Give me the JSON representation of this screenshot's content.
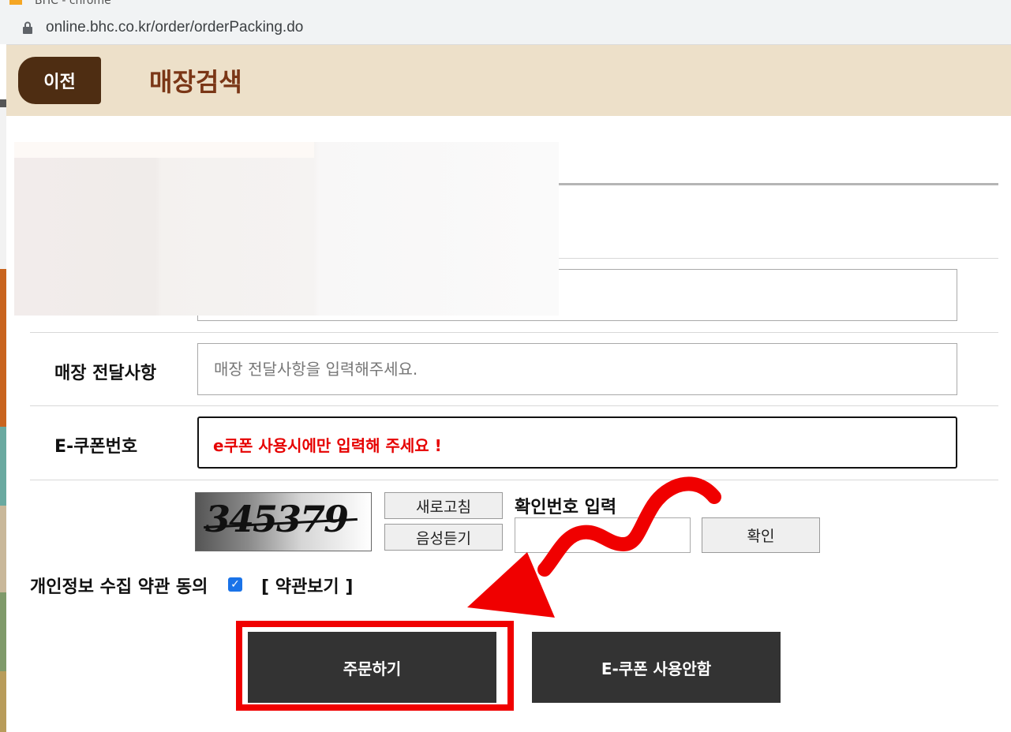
{
  "browser": {
    "tab_title": "BHC - chrome",
    "url": "online.bhc.co.kr/order/orderPacking.do"
  },
  "header": {
    "back_label": "이전",
    "title": "매장검색"
  },
  "form": {
    "store_message": {
      "label": "매장 전달사항",
      "placeholder": "매장 전달사항을 입력해주세요."
    },
    "ecoupon": {
      "label": "E-쿠폰번호",
      "placeholder": "e쿠폰 사용시에만 입력해 주세요 !"
    }
  },
  "captcha": {
    "image_text": "345379",
    "refresh_label": "새로고침",
    "audio_label": "음성듣기",
    "input_label": "확인번호 입력",
    "confirm_label": "확인"
  },
  "agreement": {
    "label": "개인정보 수집 약관 동의",
    "checked": true,
    "terms_link": "[ 약관보기 ]"
  },
  "actions": {
    "order_label": "주문하기",
    "no_coupon_label": "E-쿠폰 사용안함"
  },
  "colors": {
    "header_bg": "#ede0c9",
    "back_button": "#4e2d12",
    "title": "#7a3616",
    "action_button": "#333333",
    "annotation": "#f00000"
  }
}
